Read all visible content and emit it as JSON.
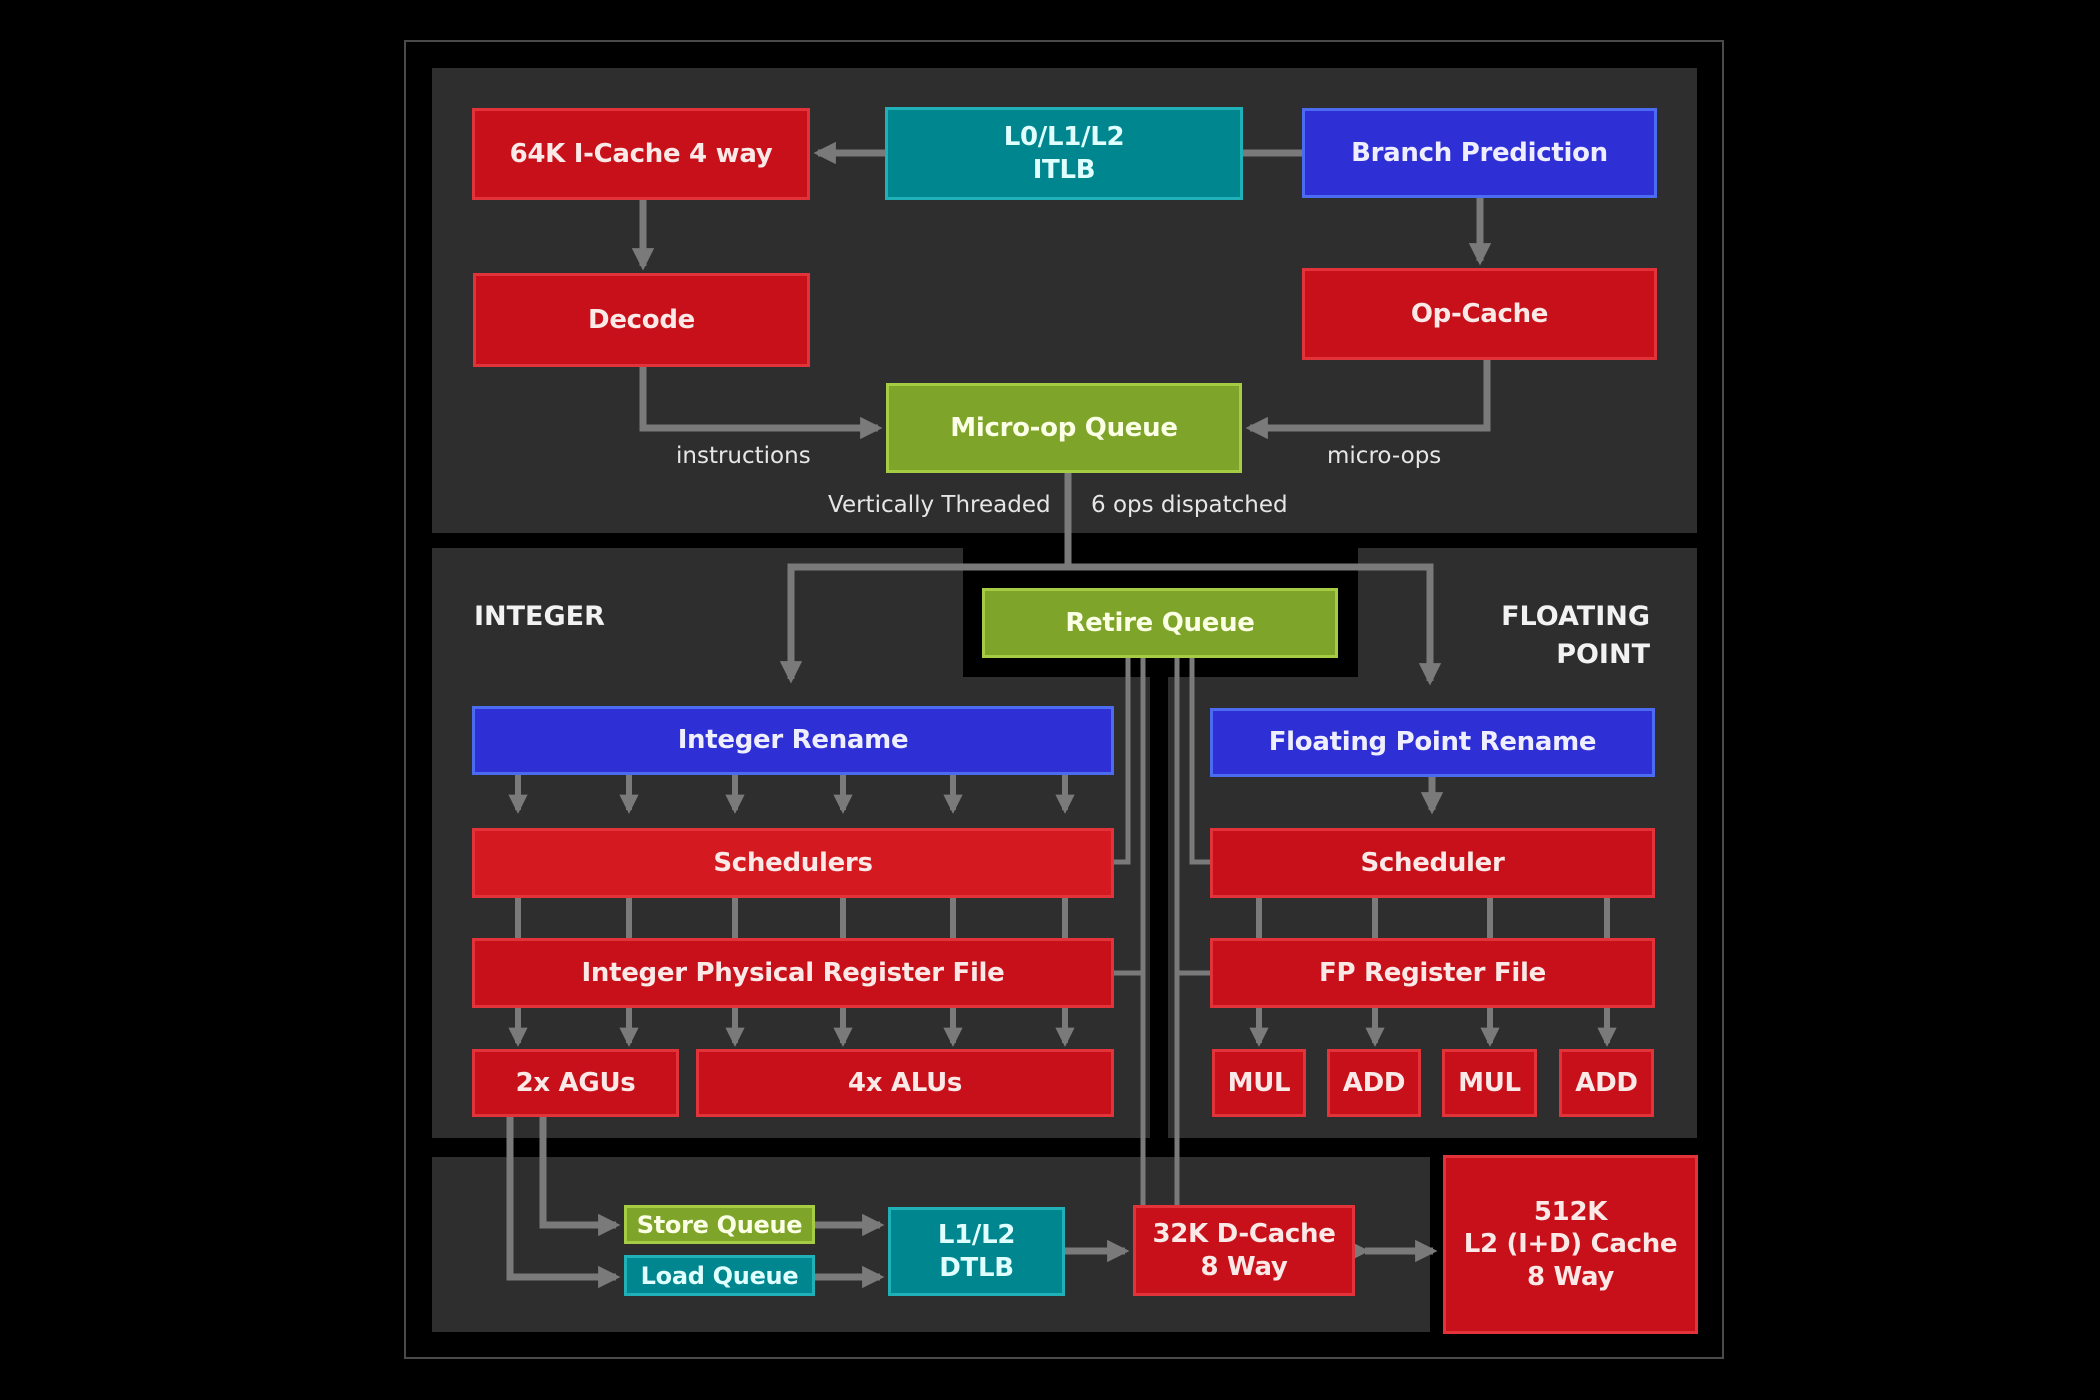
{
  "diagram": {
    "colors": {
      "cache_red": "#c8101a",
      "rename_blue": "#2f2fd6",
      "tlb_teal": "#00868f",
      "queue_green": "#7fa42a",
      "panel_gray": "#2e2e2e",
      "wire_gray": "#7a7a7a"
    },
    "frontend": {
      "icache": "64K I-Cache 4 way",
      "itlb": "L0/L1/L2\nITLB",
      "branch_prediction": "Branch Prediction",
      "decode": "Decode",
      "op_cache": "Op-Cache",
      "micro_op_queue": "Micro-op Queue",
      "label_instructions": "instructions",
      "label_micro_ops": "micro-ops",
      "label_vertically_threaded": "Vertically Threaded",
      "label_ops_dispatched": "6 ops dispatched"
    },
    "retire_queue": "Retire Queue",
    "integer": {
      "section_title": "INTEGER",
      "rename": "Integer Rename",
      "schedulers": "Schedulers",
      "register_file": "Integer Physical Register File",
      "agus": "2x AGUs",
      "alus": "4x ALUs"
    },
    "floating_point": {
      "section_title": "FLOATING\nPOINT",
      "rename": "Floating Point Rename",
      "scheduler": "Scheduler",
      "register_file": "FP Register File",
      "units": [
        "MUL",
        "ADD",
        "MUL",
        "ADD"
      ]
    },
    "memory": {
      "store_queue": "Store Queue",
      "load_queue": "Load Queue",
      "dtlb": "L1/L2\nDTLB",
      "dcache": "32K D-Cache\n8 Way",
      "l2cache": "512K\nL2 (I+D) Cache\n8 Way"
    }
  }
}
